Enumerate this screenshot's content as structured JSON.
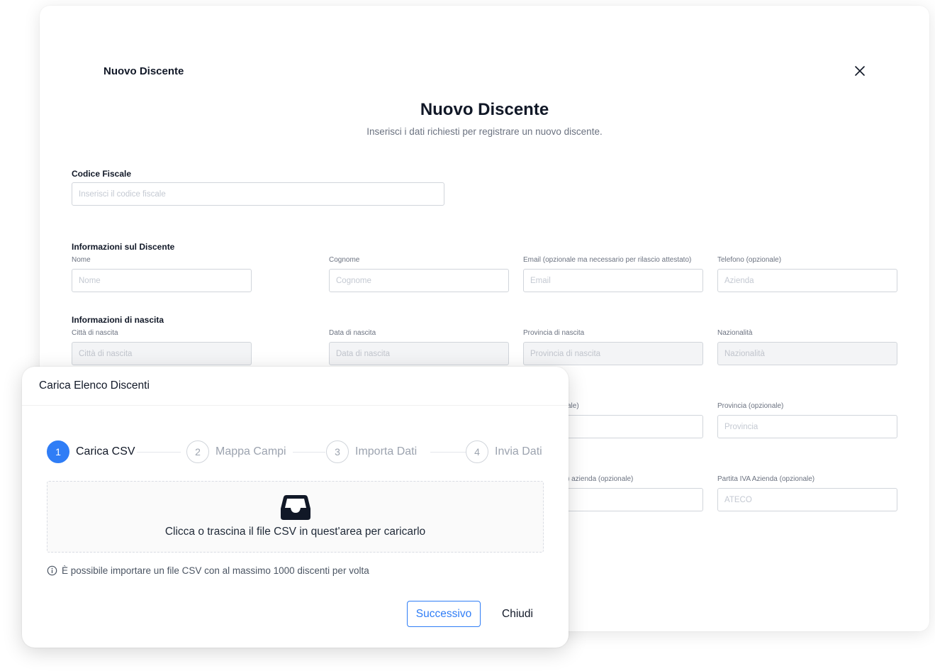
{
  "back_modal": {
    "header_title": "Nuovo Discente",
    "title": "Nuovo Discente",
    "subtitle": "Inserisci i dati richiesti per registrare un nuovo discente.",
    "codice_fiscale": {
      "label": "Codice Fiscale",
      "placeholder": "Inserisci il codice fiscale"
    },
    "info_discente": {
      "section_label": "Informazioni sul Discente",
      "fields": [
        {
          "label": "Nome",
          "placeholder": "Nome"
        },
        {
          "label": "Cognome",
          "placeholder": "Cognome"
        },
        {
          "label": "Email (opzionale ma necessario per rilascio attestato)",
          "placeholder": "Email"
        },
        {
          "label": "Telefono (opzionale)",
          "placeholder": "Azienda"
        }
      ]
    },
    "info_nascita": {
      "section_label": "Informazioni di nascita",
      "fields": [
        {
          "label": "Città di nascita",
          "placeholder": "Città di nascita"
        },
        {
          "label": "Data di nascita",
          "placeholder": "Data di nascita"
        },
        {
          "label": "Provincia di nascita",
          "placeholder": "Provincia di nascita"
        },
        {
          "label": "Nazionalità",
          "placeholder": "Nazionalità"
        }
      ]
    },
    "row3": {
      "partial_label": "ale)",
      "provincia_label": "Provincia (opzionale)",
      "provincia_placeholder": "Provincia"
    },
    "row4": {
      "partial_label": ") azienda (opzionale)",
      "piva_label": "Partita IVA Azienda (opzionale)",
      "piva_placeholder": "ATECO"
    }
  },
  "front_modal": {
    "title": "Carica Elenco Discenti",
    "steps": [
      {
        "number": "1",
        "label": "Carica CSV",
        "active": true
      },
      {
        "number": "2",
        "label": "Mappa Campi",
        "active": false
      },
      {
        "number": "3",
        "label": "Importa Dati",
        "active": false
      },
      {
        "number": "4",
        "label": "Invia Dati",
        "active": false
      }
    ],
    "dropzone_text": "Clicca o trascina il file CSV in quest'area per caricarlo",
    "info_text": "È possibile importare un file CSV con al massimo 1000 discenti per volta",
    "next_button": "Successivo",
    "close_button": "Chiudi"
  },
  "colors": {
    "accent": "#2f7df6",
    "text_dark": "#111827",
    "text_muted": "#6b7280"
  }
}
